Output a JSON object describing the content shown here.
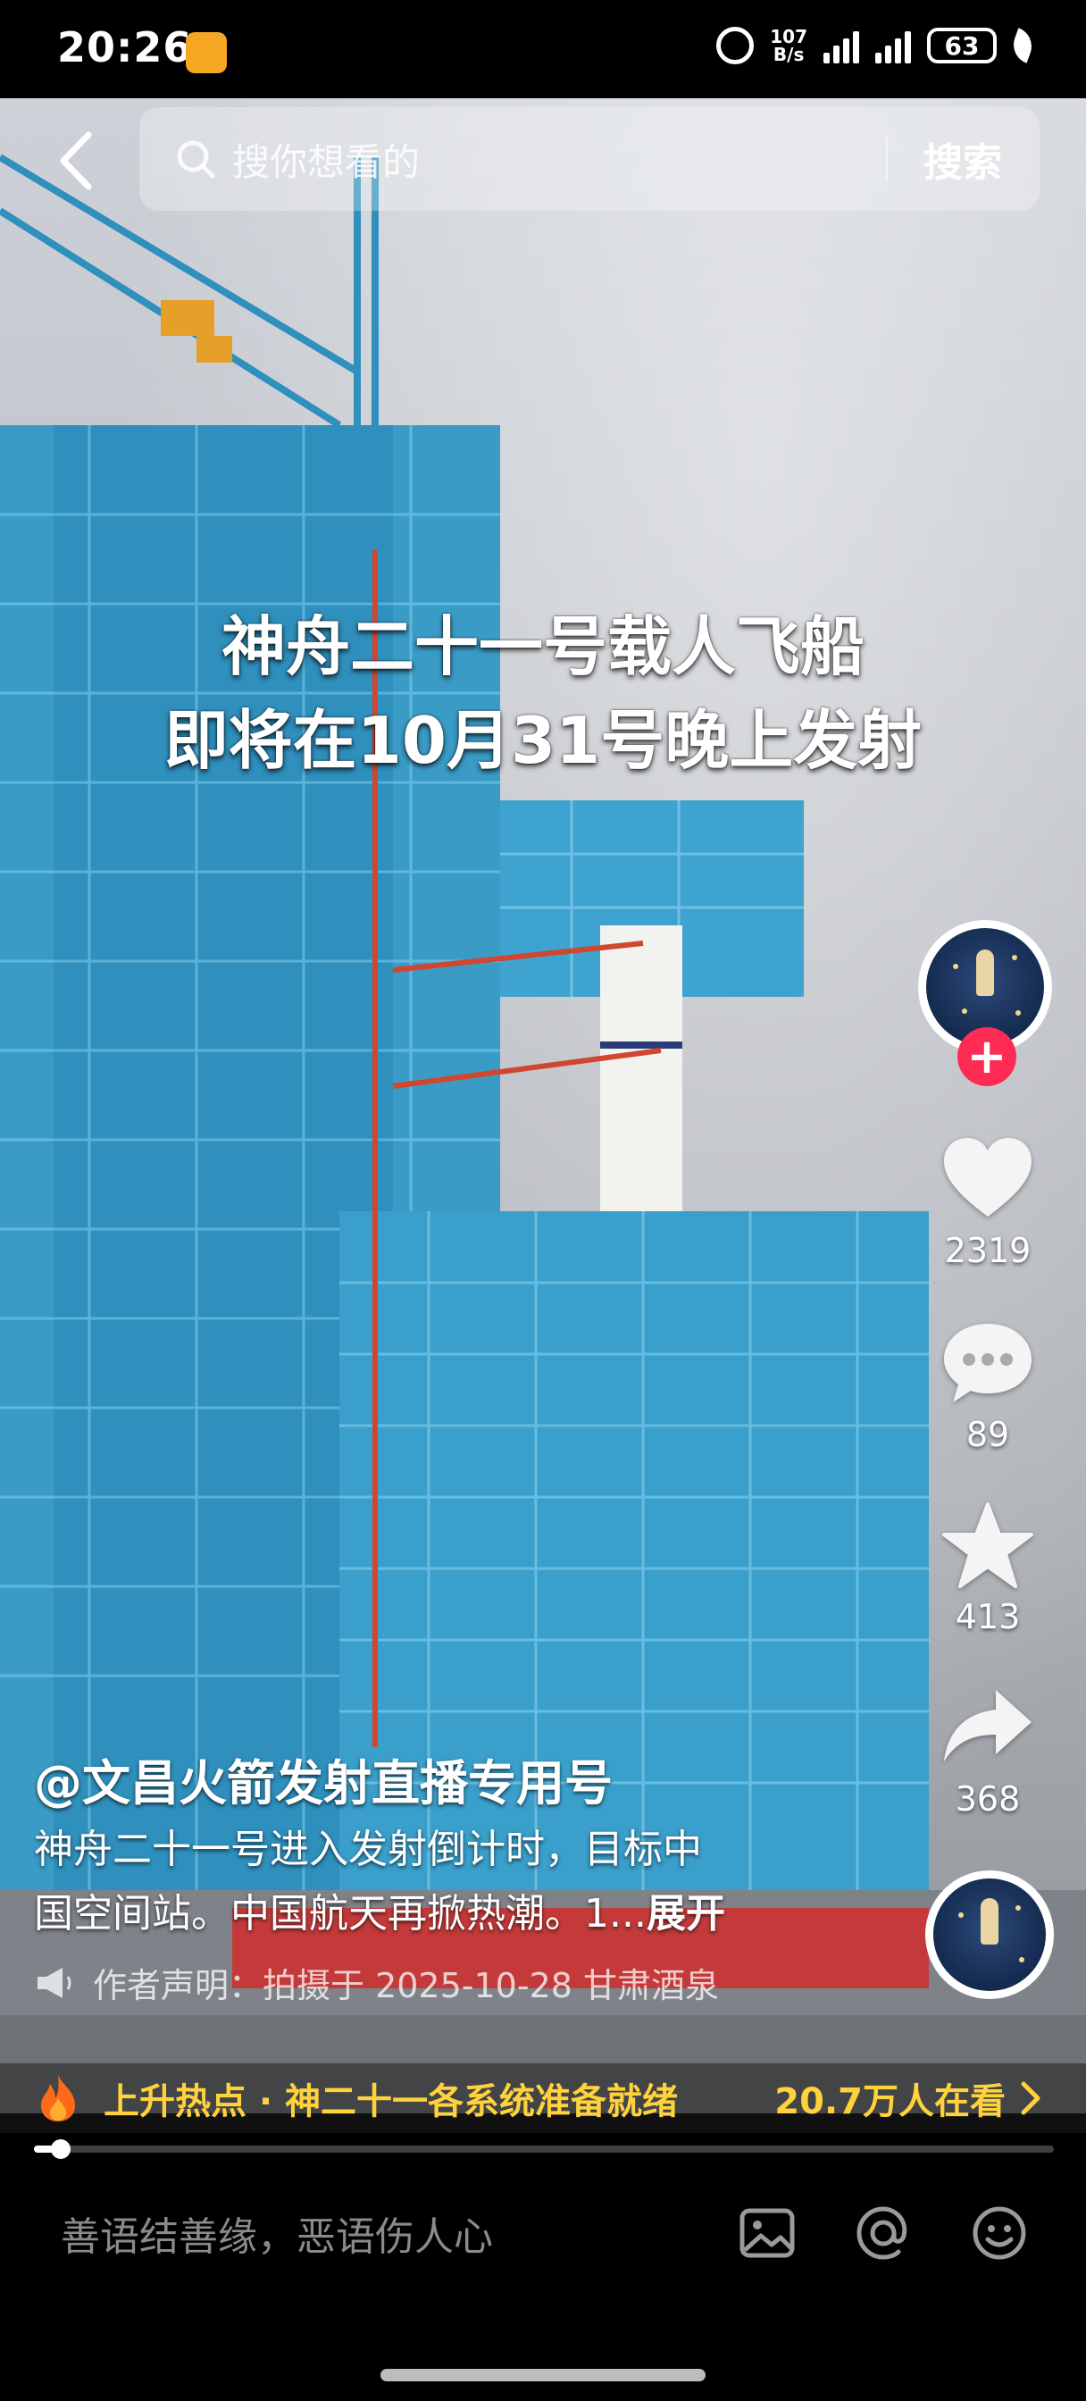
{
  "status_bar": {
    "time": "20:26",
    "net_speed_value": "107",
    "net_speed_unit": "B/s",
    "battery": "63",
    "icons": [
      "app-notification-icon",
      "alarm-icon",
      "signal-icon",
      "signal-icon",
      "battery-icon",
      "leaf-icon"
    ]
  },
  "search": {
    "placeholder": "搜你想看的",
    "button_label": "搜索"
  },
  "video": {
    "overlay_line1": "神舟二十一号载人飞船",
    "overlay_line2": "即将在10月31号晚上发射"
  },
  "author": {
    "name": "@文昌火箭发射直播专用号"
  },
  "description": {
    "line1": "神舟二十一号进入发射倒计时，目标中",
    "line2": "国空间站。中国航天再掀热潮。1...",
    "expand_label": "展开",
    "declaration": "作者声明：拍摄于 2025-10-28 甘肃酒泉"
  },
  "actions": {
    "like_count": "2319",
    "comment_count": "89",
    "favorite_count": "413",
    "share_count": "368"
  },
  "hot_topic": {
    "text": "上升热点 · 神二十一各系统准备就绪",
    "viewers": "20.7万人在看"
  },
  "playback": {
    "progress_fraction": 0.02
  },
  "comment_bar": {
    "placeholder": "善语结善缘，恶语伤人心",
    "icons": [
      "image-icon",
      "at-icon",
      "emoji-icon"
    ]
  },
  "colors": {
    "accent_red": "#fe2c55",
    "hot_yellow": "#ffd23c",
    "tower_blue": "#3a9cc6"
  }
}
